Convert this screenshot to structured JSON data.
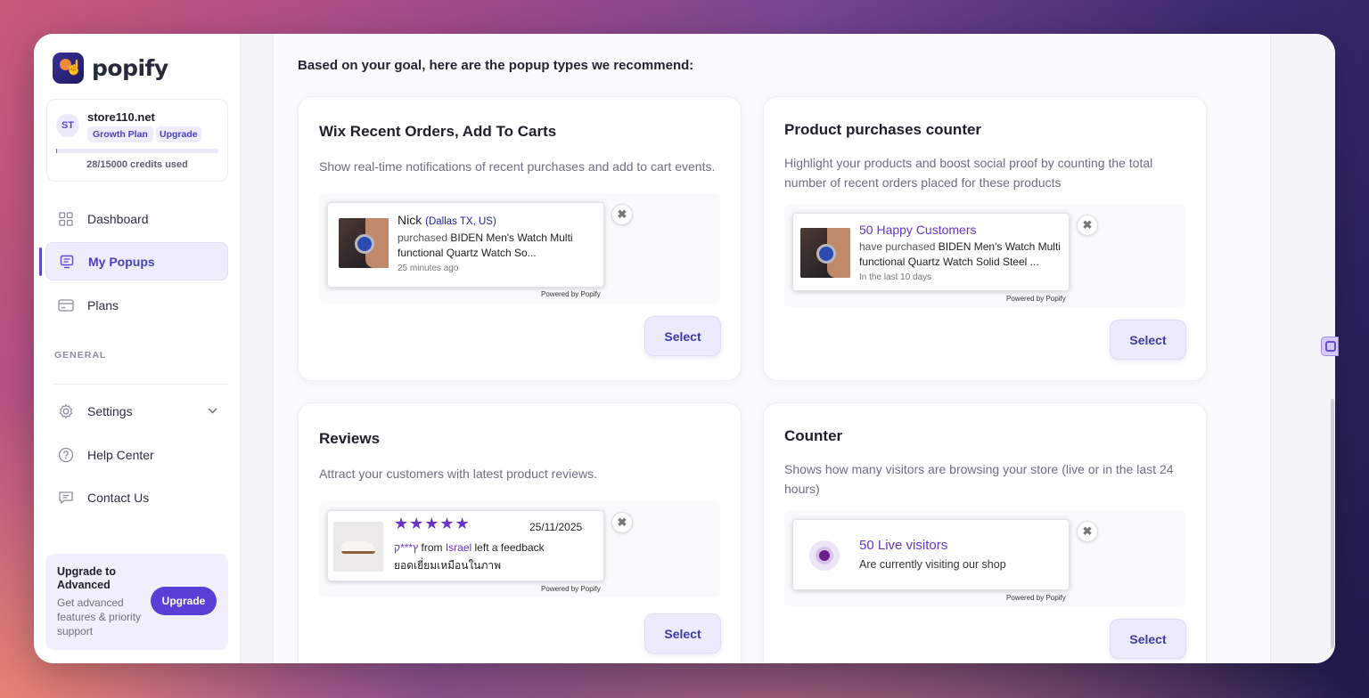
{
  "brand": {
    "name": "popify"
  },
  "store": {
    "initials": "ST",
    "name": "store110.net",
    "plan": "Growth Plan",
    "upgrade_link": "Upgrade",
    "credits_used": 28,
    "credits_total": 15000,
    "credits_text": "28/15000 credits used"
  },
  "nav": {
    "items": [
      {
        "label": "Dashboard",
        "icon": "grid-icon",
        "active": false
      },
      {
        "label": "My Popups",
        "icon": "popup-icon",
        "active": true
      },
      {
        "label": "Plans",
        "icon": "card-icon",
        "active": false
      }
    ],
    "section_label": "GENERAL",
    "general": [
      {
        "label": "Settings",
        "icon": "gear-icon"
      },
      {
        "label": "Help Center",
        "icon": "question-icon"
      },
      {
        "label": "Contact Us",
        "icon": "chat-icon"
      }
    ]
  },
  "upgrade_card": {
    "title": "Upgrade to Advanced",
    "desc": "Get advanced features & priority support",
    "button": "Upgrade"
  },
  "main": {
    "intro": "Based on your goal, here are the popup types we recommend:",
    "select_label": "Select",
    "powered": "Powered by Popify",
    "cards": [
      {
        "title": "Wix Recent Orders, Add To Carts",
        "desc": "Show real-time notifications of recent purchases and add to cart events.",
        "popup": {
          "name": "Nick",
          "location": "(Dallas TX, US)",
          "verb": "purchased",
          "product": "BIDEN Men's Watch Multi functional Quartz Watch So...",
          "time": "25 minutes ago"
        }
      },
      {
        "title": "Product purchases counter",
        "desc": "Highlight your products and boost social proof by counting the total number of recent orders placed for these products",
        "popup": {
          "headline": "50 Happy Customers",
          "verb": "have purchased",
          "product": "BIDEN Men's Watch Multi functional Quartz Watch Solid Steel ...",
          "time": "In the last 10 days"
        }
      },
      {
        "title": "Reviews",
        "desc": "Attract your customers with latest product reviews.",
        "popup": {
          "stars": "★★★★★",
          "rating": 5,
          "date": "25/11/2025",
          "reviewer": "ץ***ק",
          "from": "from",
          "country": "Israel",
          "action": "left a feedback",
          "review": "ยอดเยี่ยมเหมือนในภาพ"
        }
      },
      {
        "title": "Counter",
        "desc": "Shows how many visitors are browsing your store (live or in the last 24 hours)",
        "popup": {
          "headline": "50 Live visitors",
          "sub": "Are currently visiting our shop"
        }
      }
    ]
  },
  "colors": {
    "accent": "#5a3fd6",
    "purple_text": "#6a34c8",
    "navy_text": "#2323a0"
  }
}
